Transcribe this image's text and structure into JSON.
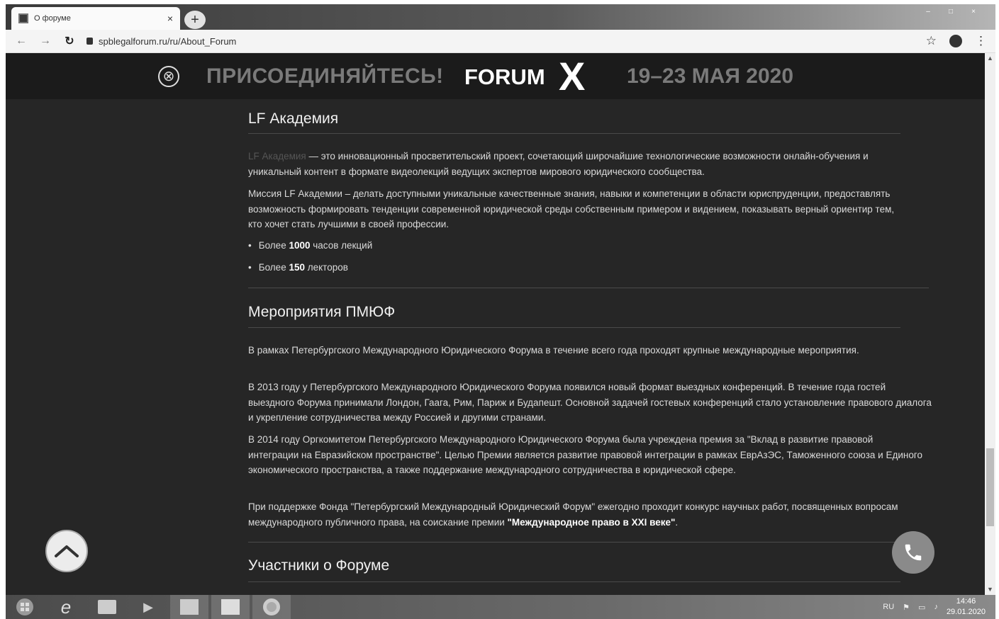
{
  "browser": {
    "tab_title": "О форуме",
    "tab_close": "×",
    "new_tab": "+",
    "url": "spblegalforum.ru/ru/About_Forum",
    "window_controls": [
      "–",
      "□",
      "×"
    ]
  },
  "banner": {
    "join": "ПРИСОЕДИНЯЙТЕСЬ!",
    "forum": "FORUM",
    "forum_x": "X",
    "dates": "19–23 МАЯ 2020",
    "close_icon": "⊗"
  },
  "academy": {
    "title": "LF Академия",
    "link_text": "LF Академия",
    "p1": " — это инновационный просветительский проект, сочетающий широчайшие технологические возможности онлайн-обучения и уникальный контент в формате видеолекций ведущих экспертов мирового юридического сообщества.",
    "p2": "Миссия LF Академии – делать доступными уникальные качественные знания, навыки и компетенции в области юриспруденции, предоставлять возможность формировать тенденции современной юридической среды собственным примером и видением, показывать верный ориентир тем, кто хочет стать лучшими в своей профессии.",
    "bullet1_pre": "Более ",
    "bullet1_num": "1000",
    "bullet1_post": " часов лекций",
    "bullet2_pre": "Более ",
    "bullet2_num": "150",
    "bullet2_post": " лекторов"
  },
  "events": {
    "title": "Мероприятия ПМЮФ",
    "p1": "В рамках Петербургского Международного Юридического Форума в течение всего года проходят крупные международные мероприятия.",
    "p2": "В 2013 году у Петербургского Международного Юридического Форума появился новый формат выездных конференций. В течение года гостей выездного Форума принимали Лондон, Гаага, Рим, Париж и Будапешт. Основной задачей гостевых конференций стало установление правового диалога и укрепление сотрудничества между Россией и другими странами.",
    "p3": "В 2014 году Оргкомитетом Петербургского Международного Юридического Форума была учреждена премия за \"Вклад в развитие правовой интеграции на Евразийском пространстве\". Целью Премии является развитие правовой интеграции в рамках ЕврАзЭС, Таможенного союза и Единого экономического пространства, а также поддержание международного сотрудничества в юридической сфере.",
    "p4_pre": "При поддержке Фонда \"Петербургский Международный Юридический Форум\" ежегодно проходит конкурс научных работ, посвященных вопросам международного публичного права, на соискание премии ",
    "p4_bold": "\"Международное право в XXI веке\"",
    "p4_post": "."
  },
  "participants": {
    "title": "Участники о Форуме"
  },
  "taskbar": {
    "lang": "RU",
    "time": "14:46",
    "date": "29.01.2020"
  }
}
